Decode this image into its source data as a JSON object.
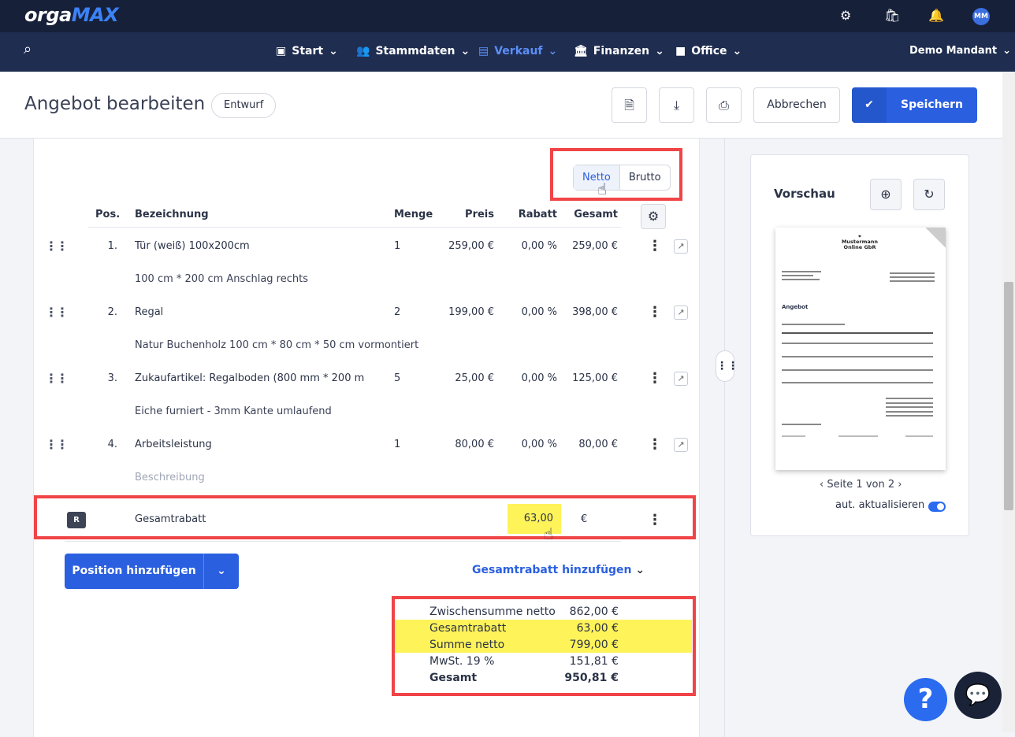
{
  "app": {
    "logo_a": "orga",
    "logo_b": "MAX",
    "user_initials": "MM"
  },
  "nav": {
    "items": [
      {
        "label": "Start"
      },
      {
        "label": "Stammdaten"
      },
      {
        "label": "Verkauf"
      },
      {
        "label": "Finanzen"
      },
      {
        "label": "Office"
      }
    ],
    "mandant": "Demo Mandant"
  },
  "header": {
    "title": "Angebot bearbeiten",
    "status": "Entwurf",
    "cancel": "Abbrechen",
    "save": "Speichern"
  },
  "toggle": {
    "netto": "Netto",
    "brutto": "Brutto"
  },
  "table": {
    "headers": {
      "pos": "Pos.",
      "bezeichnung": "Bezeichnung",
      "menge": "Menge",
      "preis": "Preis",
      "rabatt": "Rabatt",
      "gesamt": "Gesamt"
    },
    "rows": [
      {
        "pos": "1.",
        "name": "Tür (weiß) 100x200cm",
        "menge": "1",
        "preis": "259,00 €",
        "rabatt": "0,00 %",
        "gesamt": "259,00 €",
        "desc": "100 cm * 200 cm Anschlag rechts"
      },
      {
        "pos": "2.",
        "name": "Regal",
        "menge": "2",
        "preis": "199,00 €",
        "rabatt": "0,00 %",
        "gesamt": "398,00 €",
        "desc": "Natur Buchenholz 100 cm * 80 cm * 50 cm vormontiert"
      },
      {
        "pos": "3.",
        "name": "Zukaufartikel: Regalboden (800 mm * 200 m",
        "menge": "5",
        "preis": "25,00 €",
        "rabatt": "0,00 %",
        "gesamt": "125,00 €",
        "desc": "Eiche furniert - 3mm Kante umlaufend"
      },
      {
        "pos": "4.",
        "name": "Arbeitsleistung",
        "menge": "1",
        "preis": "80,00 €",
        "rabatt": "0,00 %",
        "gesamt": "80,00 €",
        "desc_placeholder": "Beschreibung"
      }
    ],
    "discount": {
      "badge": "R",
      "label": "Gesamtrabatt",
      "value": "63,00",
      "unit": "€"
    }
  },
  "actions": {
    "add_position": "Position hinzufügen",
    "add_discount": "Gesamtrabatt hinzufügen"
  },
  "totals": [
    {
      "label": "Zwischensumme netto",
      "value": "862,00 €"
    },
    {
      "label": "Gesamtrabatt",
      "value": "63,00 €",
      "highlight": true
    },
    {
      "label": "Summe netto",
      "value": "799,00 €",
      "highlight": true
    },
    {
      "label": "MwSt. 19 %",
      "value": "151,81 €"
    },
    {
      "label": "Gesamt",
      "value": "950,81 €",
      "bold": true
    }
  ],
  "preview": {
    "title": "Vorschau",
    "doc_logo": "Mustermann Online GbR",
    "doc_heading": "Angebot",
    "pager": "Seite 1 von 2",
    "auto_update": "aut. aktualisieren",
    "auto_update_on": true
  },
  "colors": {
    "accent": "#2a5fe0",
    "highlight": "#fff35a",
    "annotation": "#f04447",
    "topbar": "#172039",
    "nav": "#1f2d50"
  }
}
